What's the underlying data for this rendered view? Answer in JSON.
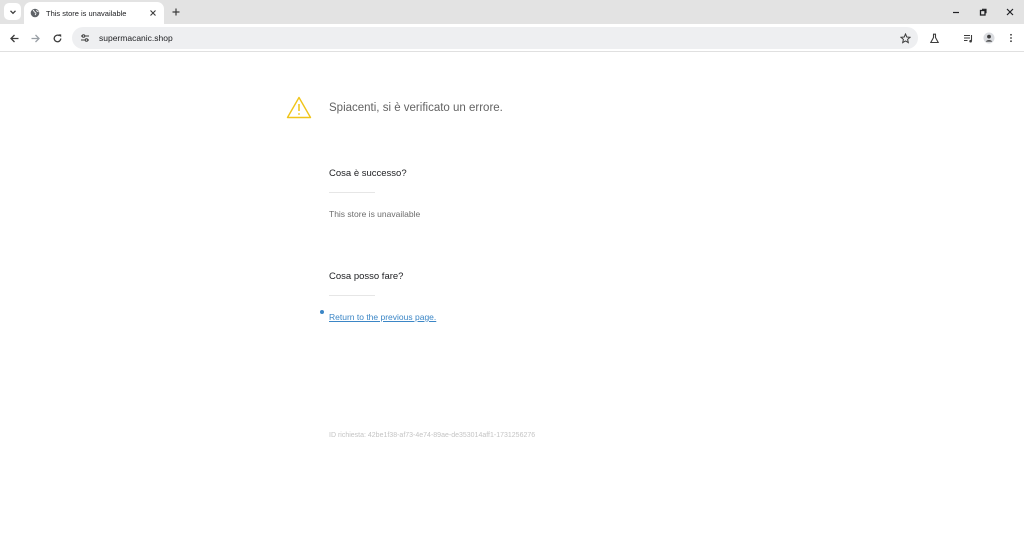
{
  "browser": {
    "tab": {
      "title": "This store is unavailable"
    },
    "url": "supermacanic.shop"
  },
  "page": {
    "headline": "Spiacenti, si è verificato un errore.",
    "what_happened": {
      "heading": "Cosa è successo?",
      "text": "This store is unavailable"
    },
    "what_to_do": {
      "heading": "Cosa posso fare?",
      "link": "Return to the previous page."
    },
    "request_id": "ID richiesta: 42be1f38-af73-4e74-89ae-de353014aff1-1731256276"
  },
  "colors": {
    "tabstrip": "#e3e3e3",
    "omnibox": "#eeeff1",
    "warning": "#f0c419",
    "link": "#3b86c6"
  },
  "icons": [
    "tab-search-icon",
    "globe-icon",
    "close-icon",
    "plus-icon",
    "minimize-icon",
    "restore-icon",
    "window-close-icon",
    "back-icon",
    "forward-icon",
    "reload-icon",
    "tune-icon",
    "star-icon",
    "labs-icon",
    "media-icon",
    "profile-icon",
    "menu-icon",
    "warning-icon"
  ]
}
